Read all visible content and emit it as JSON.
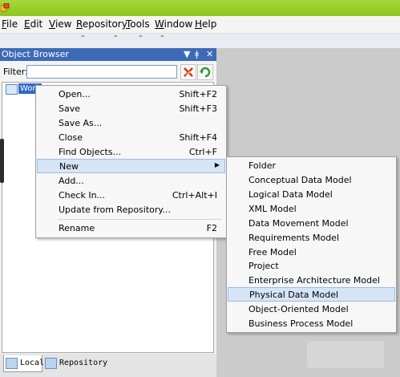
{
  "menubar": [
    {
      "label": "File",
      "mn": "F"
    },
    {
      "label": "Edit",
      "mn": "E"
    },
    {
      "label": "View",
      "mn": "V"
    },
    {
      "label": "Repository",
      "mn": "R"
    },
    {
      "label": "Tools",
      "mn": "T"
    },
    {
      "label": "Window",
      "mn": "W"
    },
    {
      "label": "Help",
      "mn": "H"
    }
  ],
  "panel": {
    "title": "Object Browser",
    "controls": [
      "▼",
      "ǂ",
      "✕"
    ],
    "filter_label": "Filter:",
    "filter_value": "",
    "tree_root": "Work"
  },
  "tabs": [
    {
      "label": "Local",
      "active": true
    },
    {
      "label": "Repository",
      "active": false
    }
  ],
  "context_menu": {
    "items": [
      {
        "label": "Open...",
        "shortcut": "Shift+F2"
      },
      {
        "label": "Save",
        "shortcut": "Shift+F3"
      },
      {
        "label": "Save As...",
        "shortcut": ""
      },
      {
        "label": "Close",
        "shortcut": "Shift+F4"
      },
      {
        "label": "Find Objects...",
        "shortcut": "Ctrl+F"
      },
      {
        "label": "New",
        "shortcut": "",
        "submenu": true,
        "highlighted": true
      },
      {
        "label": "Add...",
        "shortcut": ""
      },
      {
        "label": "Check In...",
        "shortcut": "Ctrl+Alt+I"
      },
      {
        "label": "Update from Repository...",
        "shortcut": ""
      },
      {
        "label": "Rename",
        "shortcut": "F2"
      }
    ]
  },
  "submenu": {
    "items": [
      {
        "label": "Folder"
      },
      {
        "label": "Conceptual Data Model"
      },
      {
        "label": "Logical Data Model"
      },
      {
        "label": "XML Model"
      },
      {
        "label": "Data Movement Model"
      },
      {
        "label": "Requirements Model"
      },
      {
        "label": "Free Model"
      },
      {
        "label": "Project"
      },
      {
        "label": "Enterprise Architecture Model"
      },
      {
        "label": "Physical Data Model",
        "highlighted": true
      },
      {
        "label": "Object-Oriented Model"
      },
      {
        "label": "Business Process Model"
      }
    ]
  },
  "colors": {
    "titlebar": "#8dc51d",
    "panel_title": "#3d6ab7",
    "highlight": "#d6e5f5"
  }
}
